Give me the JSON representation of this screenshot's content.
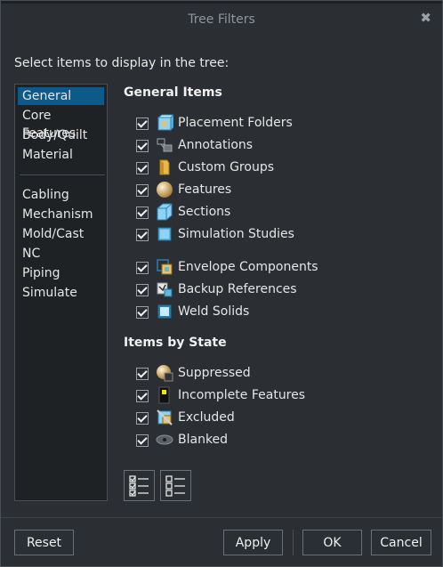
{
  "window": {
    "title": "Tree Filters",
    "close_icon": "close-icon"
  },
  "intro": "Select items to display in the tree:",
  "categories": {
    "group1": [
      "General",
      "Core Features",
      "Body/Quilt",
      "Material"
    ],
    "group2": [
      "Cabling",
      "Mechanism",
      "Mold/Cast",
      "NC",
      "Piping",
      "Simulate"
    ],
    "selected": "General"
  },
  "general_items": {
    "heading": "General Items",
    "items": [
      {
        "label": "Placement Folders",
        "checked": true,
        "icon": "placement-folders-icon"
      },
      {
        "label": "Annotations",
        "checked": true,
        "icon": "annotations-icon"
      },
      {
        "label": "Custom Groups",
        "checked": true,
        "icon": "custom-groups-icon"
      },
      {
        "label": "Features",
        "checked": true,
        "icon": "features-icon"
      },
      {
        "label": "Sections",
        "checked": true,
        "icon": "sections-icon"
      },
      {
        "label": "Simulation Studies",
        "checked": true,
        "icon": "simulation-studies-icon"
      },
      {
        "label": "Envelope Components",
        "checked": true,
        "icon": "envelope-components-icon"
      },
      {
        "label": "Backup References",
        "checked": true,
        "icon": "backup-references-icon"
      },
      {
        "label": "Weld Solids",
        "checked": true,
        "icon": "weld-solids-icon"
      }
    ]
  },
  "state_items": {
    "heading": "Items by State",
    "items": [
      {
        "label": "Suppressed",
        "checked": true,
        "icon": "suppressed-icon"
      },
      {
        "label": "Incomplete Features",
        "checked": true,
        "icon": "incomplete-features-icon"
      },
      {
        "label": "Excluded",
        "checked": true,
        "icon": "excluded-icon"
      },
      {
        "label": "Blanked",
        "checked": true,
        "icon": "blanked-icon"
      }
    ]
  },
  "tools": {
    "select_all_icon": "select-all-icon",
    "clear_all_icon": "clear-all-icon"
  },
  "buttons": {
    "reset": "Reset",
    "apply": "Apply",
    "ok": "OK",
    "cancel": "Cancel"
  },
  "colors": {
    "selection": "#0d5a8a",
    "background": "#2b2f33"
  }
}
